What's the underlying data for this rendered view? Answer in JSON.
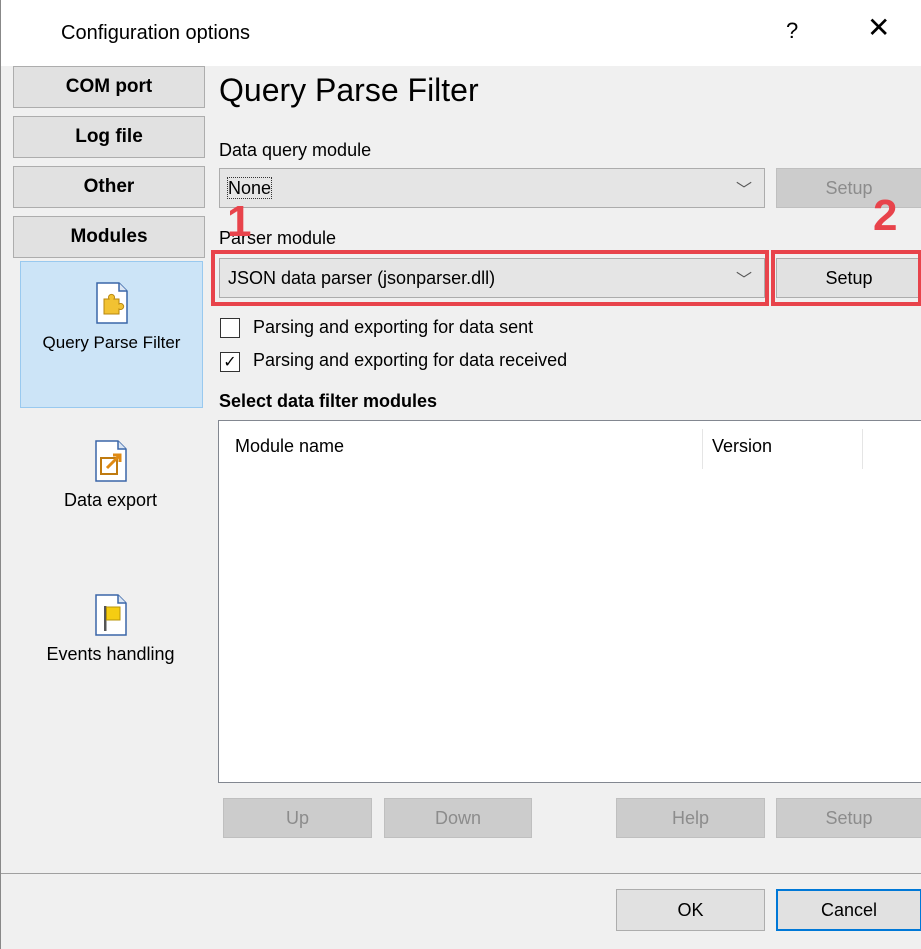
{
  "window": {
    "title": "Configuration options",
    "help_glyph": "?",
    "close_glyph": "✕"
  },
  "nav": {
    "buttons": [
      "COM port",
      "Log file",
      "Other",
      "Modules"
    ],
    "items": [
      {
        "label": "Query Parse Filter",
        "icon": "puzzle-page-icon",
        "selected": true
      },
      {
        "label": "Data export",
        "icon": "export-page-icon",
        "selected": false
      },
      {
        "label": "Events handling",
        "icon": "flag-page-icon",
        "selected": false
      }
    ]
  },
  "main": {
    "title": "Query Parse Filter",
    "data_query": {
      "label": "Data query module",
      "value": "None",
      "setup_label": "Setup"
    },
    "parser": {
      "label": "Parser module",
      "value": "JSON data parser (jsonparser.dll)",
      "setup_label": "Setup"
    },
    "options": [
      {
        "label": "Parsing and exporting for data sent",
        "checked": false
      },
      {
        "label": "Parsing and exporting for data received",
        "checked": true
      }
    ],
    "filters": {
      "heading": "Select data filter modules",
      "columns": [
        "Module name",
        "Version"
      ],
      "rows": []
    },
    "list_buttons": [
      "Up",
      "Down",
      "Help",
      "Setup"
    ]
  },
  "annotations": {
    "marker_1": "1",
    "marker_2": "2",
    "color": "#e8434b"
  },
  "footer": {
    "ok_label": "OK",
    "cancel_label": "Cancel"
  }
}
